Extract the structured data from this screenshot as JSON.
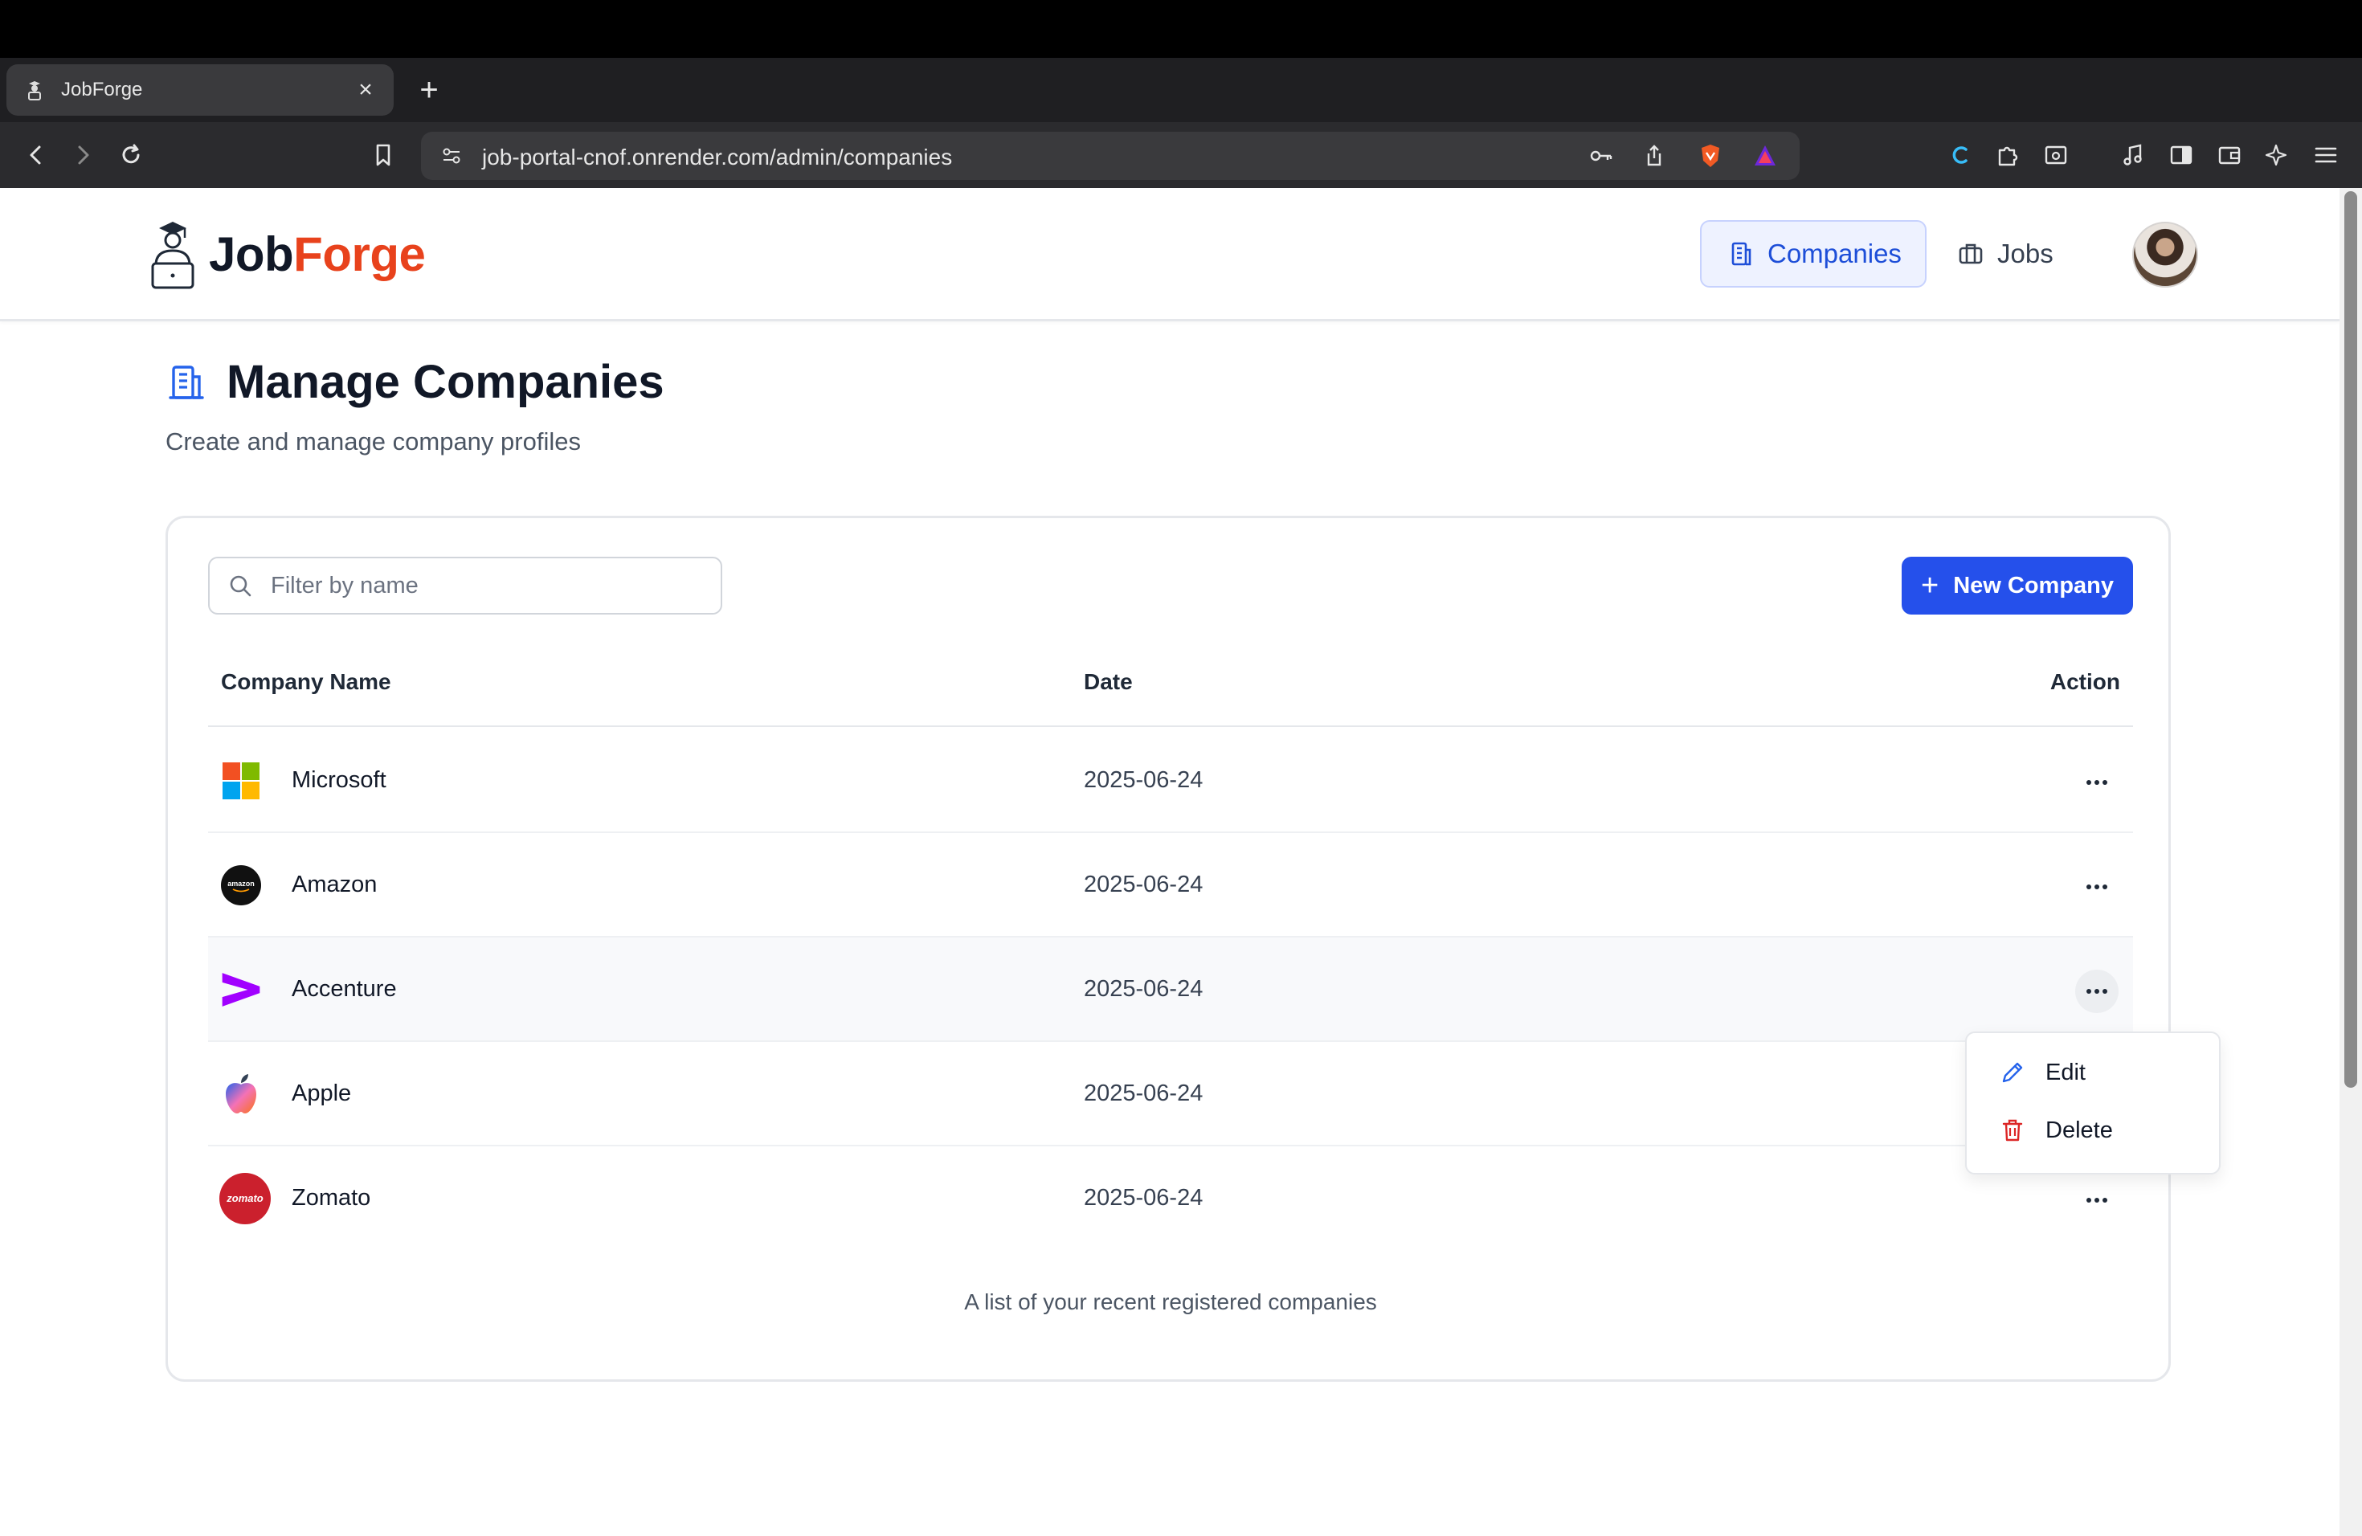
{
  "browser": {
    "tab_title": "JobForge",
    "tab_close": "×",
    "new_tab": "+",
    "url": "job-portal-cnof.onrender.com/admin/companies"
  },
  "navbar": {
    "logo_part1": "Job",
    "logo_part2": "Forge",
    "links": [
      {
        "label": "Companies",
        "active": true
      },
      {
        "label": "Jobs",
        "active": false
      }
    ]
  },
  "header": {
    "title": "Manage Companies",
    "subtitle": "Create and manage company profiles"
  },
  "toolbar": {
    "search_placeholder": "Filter by name",
    "new_button_icon": "+",
    "new_button_label": "New Company"
  },
  "table": {
    "columns": [
      "Company Name",
      "Date",
      "Action"
    ],
    "rows": [
      {
        "name": "Microsoft",
        "date": "2025-06-24",
        "logo": "microsoft-logo"
      },
      {
        "name": "Amazon",
        "date": "2025-06-24",
        "logo": "amazon-logo"
      },
      {
        "name": "Accenture",
        "date": "2025-06-24",
        "logo": "accenture-logo"
      },
      {
        "name": "Apple",
        "date": "2025-06-24",
        "logo": "apple-logo"
      },
      {
        "name": "Zomato",
        "date": "2025-06-24",
        "logo": "zomato-logo"
      }
    ],
    "caption": "A list of your recent registered companies"
  },
  "amazon_logo_text": "amazon",
  "zomato_logo_text": "zomato",
  "action_menu": {
    "items": [
      {
        "label": "Edit",
        "icon": "pencil-icon"
      },
      {
        "label": "Delete",
        "icon": "trash-icon"
      }
    ]
  },
  "colors": {
    "brand_orange": "#e8421c",
    "primary_blue": "#2550eb",
    "nav_active_bg": "#eef2ff",
    "delete_red": "#dc2626"
  }
}
